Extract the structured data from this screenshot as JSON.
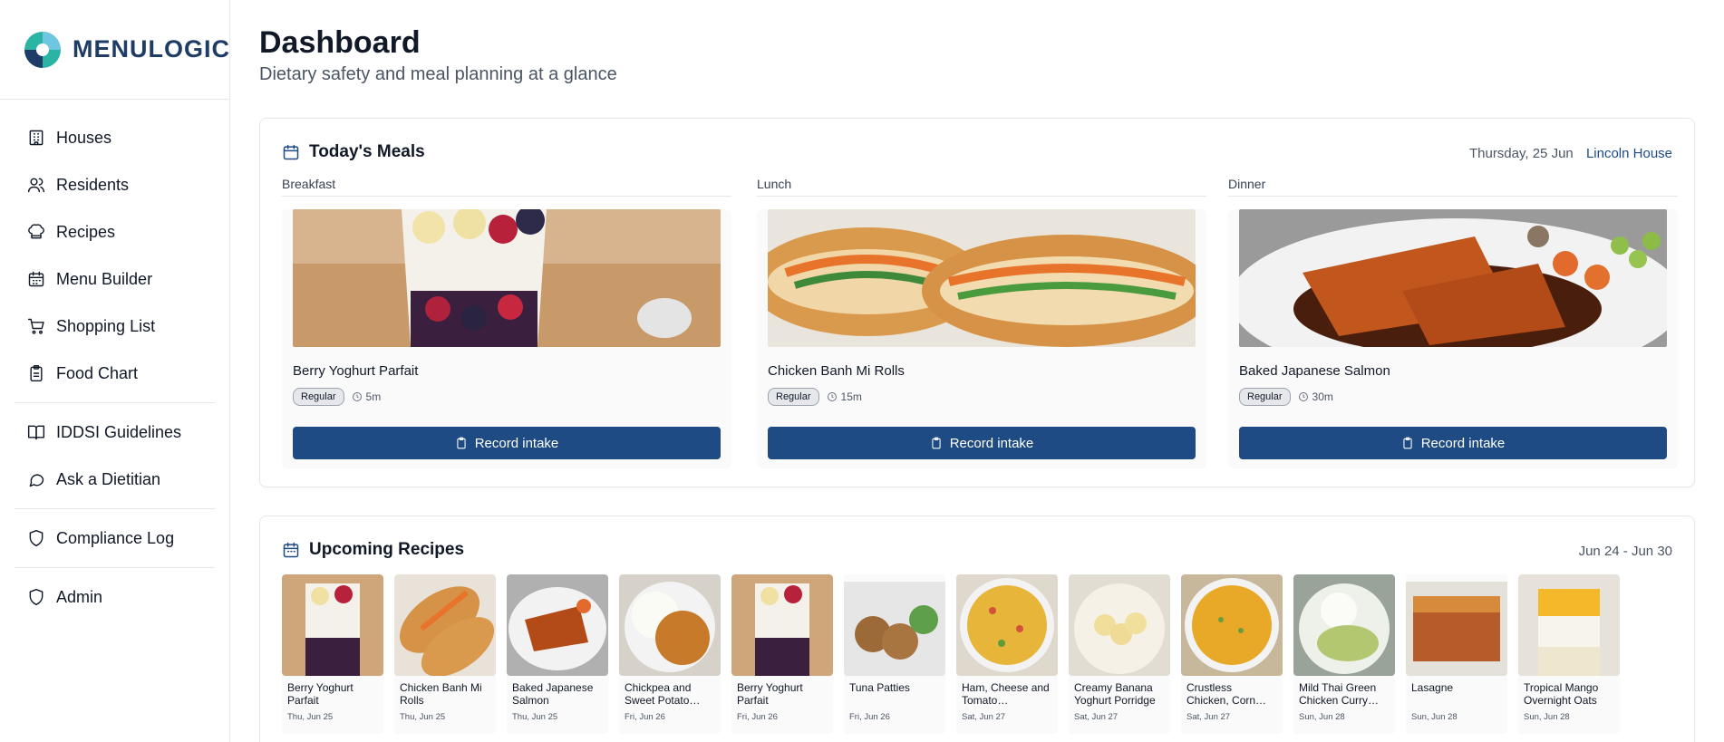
{
  "brand": {
    "name": "MENULOGIC"
  },
  "sidebar": {
    "items": [
      {
        "label": "Houses",
        "icon": "building-icon"
      },
      {
        "label": "Residents",
        "icon": "users-icon"
      },
      {
        "label": "Recipes",
        "icon": "chef-hat-icon"
      },
      {
        "label": "Menu Builder",
        "icon": "calendar-icon"
      },
      {
        "label": "Shopping List",
        "icon": "cart-icon"
      },
      {
        "label": "Food Chart",
        "icon": "clipboard-icon"
      },
      {
        "label": "IDDSI Guidelines",
        "icon": "book-icon"
      },
      {
        "label": "Ask a Dietitian",
        "icon": "chat-icon"
      },
      {
        "label": "Compliance Log",
        "icon": "shield-icon"
      },
      {
        "label": "Admin",
        "icon": "shield-icon"
      }
    ]
  },
  "header": {
    "title": "Dashboard",
    "subtitle": "Dietary safety and meal planning at a glance"
  },
  "today": {
    "title": "Today's Meals",
    "date": "Thursday, 25 Jun",
    "house": "Lincoln House",
    "meals": [
      {
        "slot": "Breakfast",
        "name": "Berry Yoghurt Parfait",
        "tag": "Regular",
        "time": "5m",
        "button": "Record intake"
      },
      {
        "slot": "Lunch",
        "name": "Chicken Banh Mi Rolls",
        "tag": "Regular",
        "time": "15m",
        "button": "Record intake"
      },
      {
        "slot": "Dinner",
        "name": "Baked Japanese Salmon",
        "tag": "Regular",
        "time": "30m",
        "button": "Record intake"
      }
    ]
  },
  "upcoming": {
    "title": "Upcoming Recipes",
    "range": "Jun 24 - Jun 30",
    "recipes": [
      {
        "name": "Berry Yoghurt Parfait",
        "date": "Thu, Jun 25"
      },
      {
        "name": "Chicken Banh Mi Rolls",
        "date": "Thu, Jun 25"
      },
      {
        "name": "Baked Japanese Salmon",
        "date": "Thu, Jun 25"
      },
      {
        "name": "Chickpea and Sweet Potato…",
        "date": "Fri, Jun 26"
      },
      {
        "name": "Berry Yoghurt Parfait",
        "date": "Fri, Jun 26"
      },
      {
        "name": "Tuna Patties",
        "date": "Fri, Jun 26"
      },
      {
        "name": "Ham, Cheese and Tomato…",
        "date": "Sat, Jun 27"
      },
      {
        "name": "Creamy Banana Yoghurt Porridge",
        "date": "Sat, Jun 27"
      },
      {
        "name": "Crustless Chicken, Corn…",
        "date": "Sat, Jun 27"
      },
      {
        "name": "Mild Thai Green Chicken Curry…",
        "date": "Sun, Jun 28"
      },
      {
        "name": "Lasagne",
        "date": "Sun, Jun 28"
      },
      {
        "name": "Tropical Mango Overnight Oats",
        "date": "Sun, Jun 28"
      }
    ]
  },
  "colors": {
    "accent": "#1e4b84",
    "logo_text": "#1f3c66"
  }
}
